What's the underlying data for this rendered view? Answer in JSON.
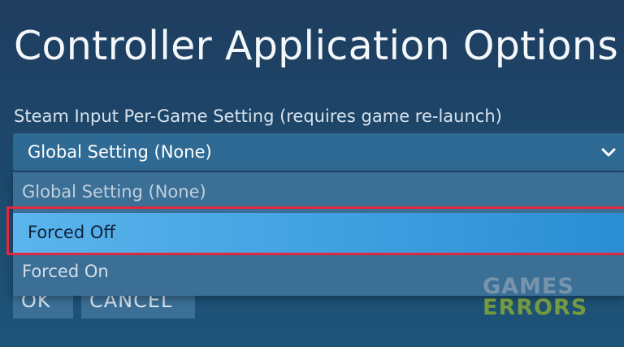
{
  "dialog": {
    "title": "Controller Application Options"
  },
  "setting": {
    "label": "Steam Input Per-Game Setting (requires game re-launch)",
    "selected_value": "Global Setting (None)",
    "options": [
      {
        "label": "Global Setting (None)"
      },
      {
        "label": "Forced Off"
      },
      {
        "label": "Forced On"
      }
    ],
    "highlighted_option": "Forced Off"
  },
  "buttons": {
    "ok_label": "OK",
    "cancel_label": "CANCEL"
  },
  "watermark": {
    "line1": "GAMES",
    "line2": "ERRORS"
  },
  "colors": {
    "background": "#1f3d5f",
    "select_bg": "#2f6a94",
    "highlight_option": "#3fa0e0",
    "annotation_frame": "#e0293d",
    "watermark_green": "#7ea23a"
  },
  "icons": {
    "dropdown": "chevron-down-icon"
  }
}
